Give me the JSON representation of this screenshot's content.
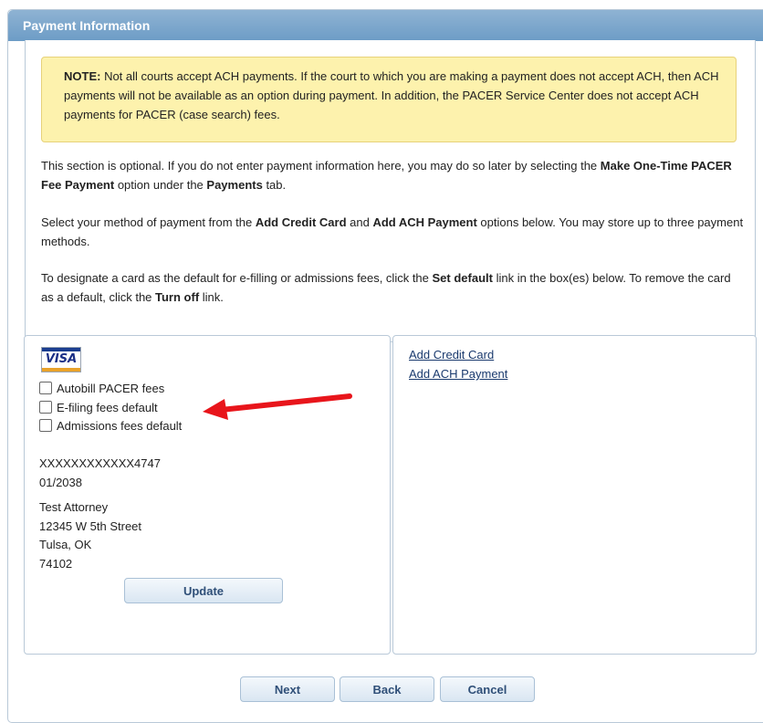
{
  "panel": {
    "title": "Payment Information"
  },
  "note": {
    "label": "NOTE:",
    "text": " Not all courts accept ACH payments. If the court to which you are making a payment does not accept ACH, then ACH payments will not be available as an option during payment. In addition, the PACER Service Center does not accept ACH payments for PACER (case search) fees."
  },
  "paragraphs": {
    "p1": {
      "a": "This section is optional. If you do not enter payment information here, you may do so later by selecting the ",
      "b": "Make One-Time PACER Fee Payment",
      "c": " option under the ",
      "d": "Payments",
      "e": " tab."
    },
    "p2": {
      "a": "Select your method of payment from the ",
      "b": "Add Credit Card",
      "c": " and ",
      "d": "Add ACH Payment",
      "e": " options below. You may store up to three payment methods."
    },
    "p3": {
      "a": "To designate a card as the default for e-filling or admissions fees, click the ",
      "b": "Set default",
      "c": " link in the box(es) below. To remove the card as a default, click the ",
      "d": "Turn off",
      "e": " link."
    }
  },
  "card": {
    "brand_logo_text": "VISA",
    "checkboxes": [
      {
        "label": "Autobill PACER fees",
        "checked": false
      },
      {
        "label": "E-filing fees default",
        "checked": false
      },
      {
        "label": "Admissions fees default",
        "checked": false
      }
    ],
    "number": "XXXXXXXXXXXX4747",
    "expiry": "01/2038",
    "name": "Test Attorney",
    "street": "12345 W 5th Street",
    "city_state": "Tulsa, OK",
    "zip": "74102",
    "update_label": "Update"
  },
  "links": {
    "add_credit_card": "Add Credit Card",
    "add_ach_payment": "Add ACH Payment"
  },
  "footer": {
    "next_label": "Next",
    "back_label": "Back",
    "cancel_label": "Cancel"
  },
  "annotation": {
    "arrow_color": "#e8151b"
  }
}
